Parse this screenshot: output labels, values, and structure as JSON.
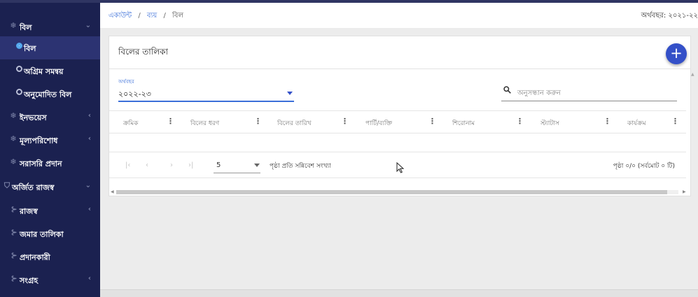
{
  "sidebar": {
    "items": [
      {
        "label": "বিল",
        "icon": "snowflake-icon",
        "chevron": "⌄"
      },
      {
        "label": "বিল",
        "icon": "radio-dot-icon"
      },
      {
        "label": "অগ্রিম সমন্বয়",
        "icon": "radio-dot-icon"
      },
      {
        "label": "অনুমোদিত বিল",
        "icon": "radio-dot-icon"
      },
      {
        "label": "ইনভয়েস",
        "icon": "snowflake-icon",
        "chevron": "‹"
      },
      {
        "label": "মূল্যপরিশোধ",
        "icon": "snowflake-icon",
        "chevron": "‹"
      },
      {
        "label": "সরাসরি প্রদান",
        "icon": "snowflake-icon"
      },
      {
        "label": "অর্জিত রাজস্ব",
        "icon": "shield-icon",
        "chevron": "⌄"
      },
      {
        "label": "রাজস্ব",
        "icon": "branch-icon",
        "chevron": "‹"
      },
      {
        "label": "জমার তালিকা",
        "icon": "branch-icon"
      },
      {
        "label": "প্রদানকারী",
        "icon": "branch-icon"
      },
      {
        "label": "সংগ্রহ",
        "icon": "branch-icon",
        "chevron": "‹"
      }
    ]
  },
  "header": {
    "breadcrumb": [
      "একাউন্ট",
      "ব্যয়",
      "বিল"
    ],
    "fiscal_year": "অর্থবছর: ২০২১-২২"
  },
  "card": {
    "title": "বিলের তালিকা",
    "add_button": "+"
  },
  "filter": {
    "label": "অর্থবছর",
    "value": "২০২২-২৩"
  },
  "search": {
    "placeholder": "অনুসন্ধান করুন"
  },
  "table": {
    "columns": [
      "ক্রমিক",
      "বিলের ধরণ",
      "বিলের তারিখ",
      "পার্টি/ব্যক্তি",
      "শিরোনাম",
      "স্ট্যাটাস",
      "কার্যক্রম"
    ],
    "rows": []
  },
  "pagination": {
    "first": "|‹",
    "prev": "‹",
    "next": "›",
    "last": "›|",
    "rows_per_page": "5",
    "rows_per_page_label": "পৃষ্ঠা প্রতি সন্নিবেশ সংখ্যা",
    "page_info": "পৃষ্ঠা ০/০ (সর্বমোট ০ টি)"
  },
  "colors": {
    "sidebar_bg": "#1b2150",
    "accent": "#3450c8",
    "link": "#3b6fd9"
  }
}
